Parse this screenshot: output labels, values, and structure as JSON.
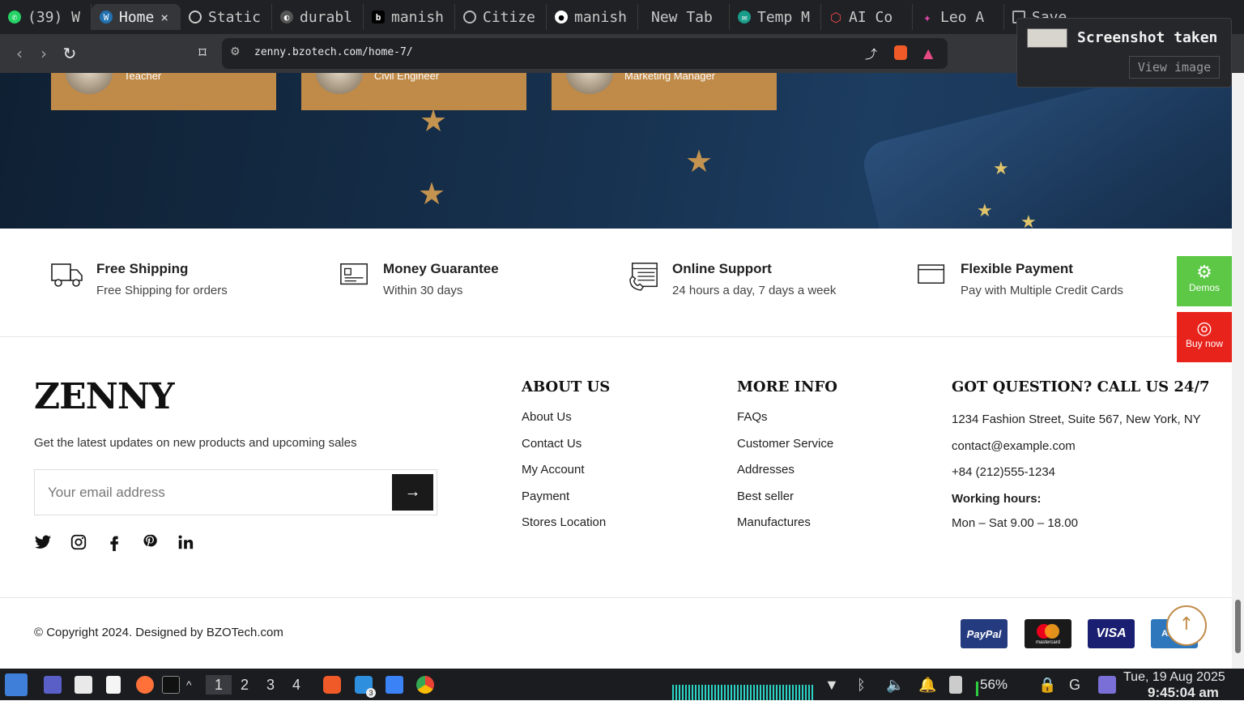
{
  "browser": {
    "tabs": [
      {
        "label": "(39) W",
        "icon": "whatsapp-icon",
        "color": "#25d366"
      },
      {
        "label": "Home",
        "icon": "wordpress-icon",
        "color": "#2271b1",
        "active": true
      },
      {
        "label": "Static",
        "icon": "openai-icon",
        "color": "#cccccc"
      },
      {
        "label": "durabl",
        "icon": "durable-icon",
        "color": "#888888"
      },
      {
        "label": "manish",
        "icon": "behance-icon",
        "color": "#000000"
      },
      {
        "label": "Citize",
        "icon": "globe-icon",
        "color": "#bbbbbb"
      },
      {
        "label": "manish",
        "icon": "github-icon",
        "color": "#ffffff"
      },
      {
        "label": "New Tab",
        "icon": "",
        "color": ""
      },
      {
        "label": "Temp M",
        "icon": "temp-mail-icon",
        "color": "#1a9c8a"
      },
      {
        "label": "AI Co",
        "icon": "ai-code-icon",
        "color": "#e5484d"
      },
      {
        "label": "Leo A",
        "icon": "leo-icon",
        "color": "#d946a8"
      },
      {
        "label": "Save",
        "icon": "save-icon",
        "color": "#aaaaaa"
      }
    ],
    "url": "zenny.bzotech.com/home-7/",
    "notification": {
      "title": "Screenshot taken",
      "action": "View image"
    }
  },
  "hero": {
    "cards": [
      {
        "role": "Teacher"
      },
      {
        "role": "Civil Engineer"
      },
      {
        "role": "Marketing Manager"
      }
    ]
  },
  "features": [
    {
      "icon": "truck-icon",
      "title": "Free Shipping",
      "subtitle": "Free Shipping for orders"
    },
    {
      "icon": "money-card-icon",
      "title": "Money Guarantee",
      "subtitle": "Within 30 days"
    },
    {
      "icon": "support-calendar-icon",
      "title": "Online Support",
      "subtitle": "24 hours a day, 7 days a week"
    },
    {
      "icon": "credit-card-icon",
      "title": "Flexible Payment",
      "subtitle": "Pay with Multiple Credit Cards"
    }
  ],
  "side_buttons": {
    "demos": "Demos",
    "buy_now": "Buy now",
    "demos_color": "#5cc846",
    "buy_color": "#e8231c"
  },
  "footer": {
    "logo": "ZENNY",
    "tagline": "Get the latest updates on new products and upcoming sales",
    "email_placeholder": "Your email address",
    "social": [
      "twitter-icon",
      "instagram-icon",
      "facebook-icon",
      "pinterest-icon",
      "linkedin-icon"
    ],
    "about": {
      "title": "ABOUT US",
      "links": [
        "About Us",
        "Contact Us",
        "My Account",
        "Payment",
        "Stores Location"
      ]
    },
    "more": {
      "title": "MORE INFO",
      "links": [
        "FAQs",
        "Customer Service",
        "Addresses",
        "Best seller",
        "Manufactures"
      ]
    },
    "contact": {
      "title": "GOT QUESTION? CALL US 24/7",
      "address": "1234 Fashion Street, Suite 567, New York, NY",
      "email": "contact@example.com",
      "phone": "+84 (212)555-1234",
      "hours_label": "Working hours:",
      "hours": "Mon – Sat 9.00 – 18.00"
    },
    "copyright": "© Copyright 2024. Designed by BZOTech.com",
    "payments": [
      {
        "name": "PayPal",
        "color": "#253b80"
      },
      {
        "name": "mastercard",
        "color": "#1a1a1a"
      },
      {
        "name": "VISA",
        "color": "#1a1f71"
      },
      {
        "name": "AMEX",
        "color": "#2e77bc"
      }
    ]
  },
  "taskbar": {
    "workspaces": [
      "1",
      "2",
      "3",
      "4"
    ],
    "vscode_badge": "3",
    "battery": "56%",
    "date": "Tue, 19 Aug 2025",
    "time": "9:45:04 am"
  }
}
